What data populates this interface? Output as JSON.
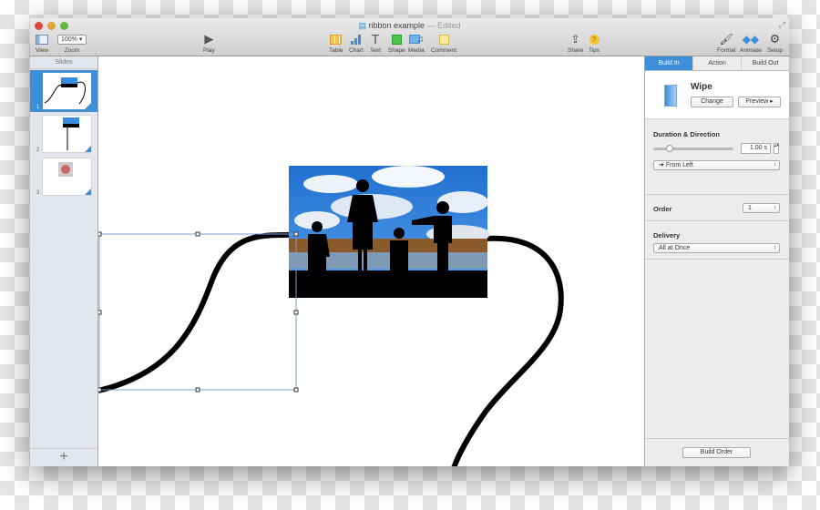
{
  "window": {
    "title": "ribbon example",
    "edited": "— Edited"
  },
  "toolbar": {
    "view": "View",
    "zoom": "Zoom",
    "zoom_value": "100%",
    "play": "Play",
    "table": "Table",
    "chart": "Chart",
    "text": "Text",
    "shape": "Shape",
    "media": "Media",
    "comment": "Comment",
    "share": "Share",
    "tips": "Tips",
    "format": "Format",
    "animate": "Animate",
    "setup": "Setup"
  },
  "sidebar": {
    "header": "Slides",
    "slides": [
      {
        "number": "1",
        "selected": true
      },
      {
        "number": "2"
      },
      {
        "number": "3"
      }
    ],
    "add": "+"
  },
  "inspector": {
    "tabs": [
      {
        "label": "Build In",
        "active": true
      },
      {
        "label": "Action"
      },
      {
        "label": "Build Out"
      }
    ],
    "effect": "Wipe",
    "change": "Change",
    "preview": "Preview ▸",
    "duration_label": "Duration & Direction",
    "duration_value": "1.00 s",
    "duration_slider_fraction": 0.2,
    "direction": "From Left",
    "order_label": "Order",
    "order_value": "1",
    "delivery_label": "Delivery",
    "delivery_value": "All at Once",
    "build_order": "Build Order"
  },
  "colors": {
    "accent": "#3d8fd8"
  }
}
